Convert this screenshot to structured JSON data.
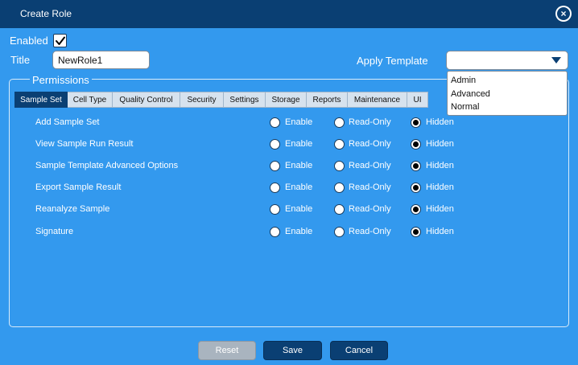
{
  "window": {
    "title": "Create Role"
  },
  "form": {
    "enabled_label": "Enabled",
    "enabled_checked": true,
    "title_label": "Title",
    "title_value": "NewRole1",
    "apply_template_label": "Apply Template",
    "apply_template_value": "",
    "template_options": [
      "Admin",
      "Advanced",
      "Normal"
    ]
  },
  "permissions": {
    "group_title": "Permissions",
    "tabs": [
      "Sample Set",
      "Cell Type",
      "Quality Control",
      "Security",
      "Settings",
      "Storage",
      "Reports",
      "Maintenance",
      "UI"
    ],
    "active_tab": "Sample Set",
    "option_labels": [
      "Enable",
      "Read-Only",
      "Hidden"
    ],
    "rows": [
      {
        "label": "Add Sample Set",
        "selected": "Hidden"
      },
      {
        "label": "View Sample Run Result",
        "selected": "Hidden"
      },
      {
        "label": "Sample Template Advanced Options",
        "selected": "Hidden"
      },
      {
        "label": "Export Sample Result",
        "selected": "Hidden"
      },
      {
        "label": "Reanalyze Sample",
        "selected": "Hidden"
      },
      {
        "label": "Signature",
        "selected": "Hidden"
      }
    ]
  },
  "buttons": {
    "reset": "Reset",
    "save": "Save",
    "cancel": "Cancel"
  },
  "colors": {
    "background": "#3399ee",
    "titlebar": "#0a3f73",
    "accent": "#0a3f73"
  }
}
